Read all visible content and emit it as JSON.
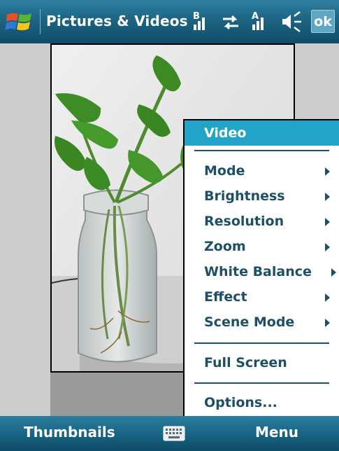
{
  "titlebar": {
    "title": "Pictures & Videos",
    "ok_label": "ok",
    "icons": [
      "windows-start-icon",
      "bluetooth-signal-icon",
      "sync-arrows-icon",
      "signal-strength-icon",
      "volume-icon"
    ],
    "signal_badge_b": "B",
    "signal_badge_a": "A"
  },
  "menu": {
    "header": "Video",
    "items": [
      {
        "label": "Mode",
        "submenu": true
      },
      {
        "label": "Brightness",
        "submenu": true
      },
      {
        "label": "Resolution",
        "submenu": true
      },
      {
        "label": "Zoom",
        "submenu": true
      },
      {
        "label": "White Balance",
        "submenu": true
      },
      {
        "label": "Effect",
        "submenu": true
      },
      {
        "label": "Scene Mode",
        "submenu": true
      }
    ],
    "full_screen": "Full Screen",
    "options": "Options..."
  },
  "softkeys": {
    "left": "Thumbnails",
    "right": "Menu"
  },
  "colors": {
    "titlebar": "#1d6483",
    "menu_highlight": "#22a3c8",
    "menu_text": "#1d4f66"
  }
}
